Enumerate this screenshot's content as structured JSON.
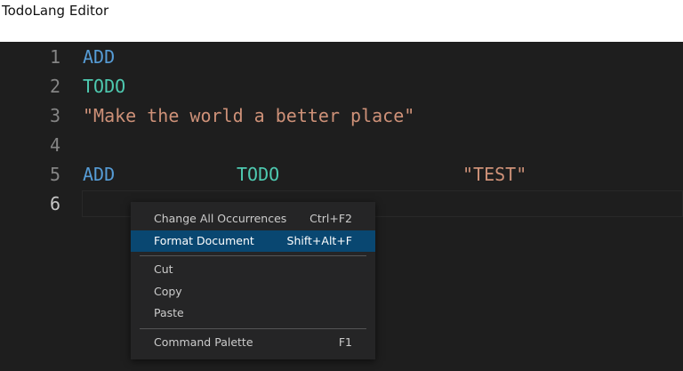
{
  "window": {
    "title": "TodoLang Editor"
  },
  "editor": {
    "lines": [
      {
        "number": "1",
        "tokens": [
          {
            "text": "ADD",
            "kind": "keyword-add"
          }
        ]
      },
      {
        "number": "2",
        "tokens": [
          {
            "text": "TODO",
            "kind": "keyword-todo"
          }
        ]
      },
      {
        "number": "3",
        "tokens": [
          {
            "text": "\"Make the world a better place\"",
            "kind": "string"
          }
        ]
      },
      {
        "number": "4",
        "tokens": []
      },
      {
        "number": "5",
        "tokens": [
          {
            "text": "ADD",
            "kind": "keyword-add"
          },
          {
            "text": "TODO",
            "kind": "keyword-todo"
          },
          {
            "text": "\"TEST\"",
            "kind": "string"
          }
        ]
      },
      {
        "number": "6",
        "tokens": [],
        "active": true
      }
    ],
    "colors": {
      "background": "#1e1e1e",
      "line_number": "#858585",
      "line_number_active": "#c6c6c6",
      "keyword_add": "#569cd6",
      "keyword_todo": "#4ec9b0",
      "string": "#ce9178"
    }
  },
  "context_menu": {
    "items": [
      {
        "label": "Change All Occurrences",
        "shortcut": "Ctrl+F2"
      },
      {
        "label": "Format Document",
        "shortcut": "Shift+Alt+F",
        "selected": true
      },
      {
        "label": "Cut",
        "shortcut": ""
      },
      {
        "label": "Copy",
        "shortcut": ""
      },
      {
        "label": "Paste",
        "shortcut": ""
      },
      {
        "label": "Command Palette",
        "shortcut": "F1"
      }
    ],
    "colors": {
      "background": "#252526",
      "selected_background": "#094771",
      "text": "#cccccc"
    }
  }
}
